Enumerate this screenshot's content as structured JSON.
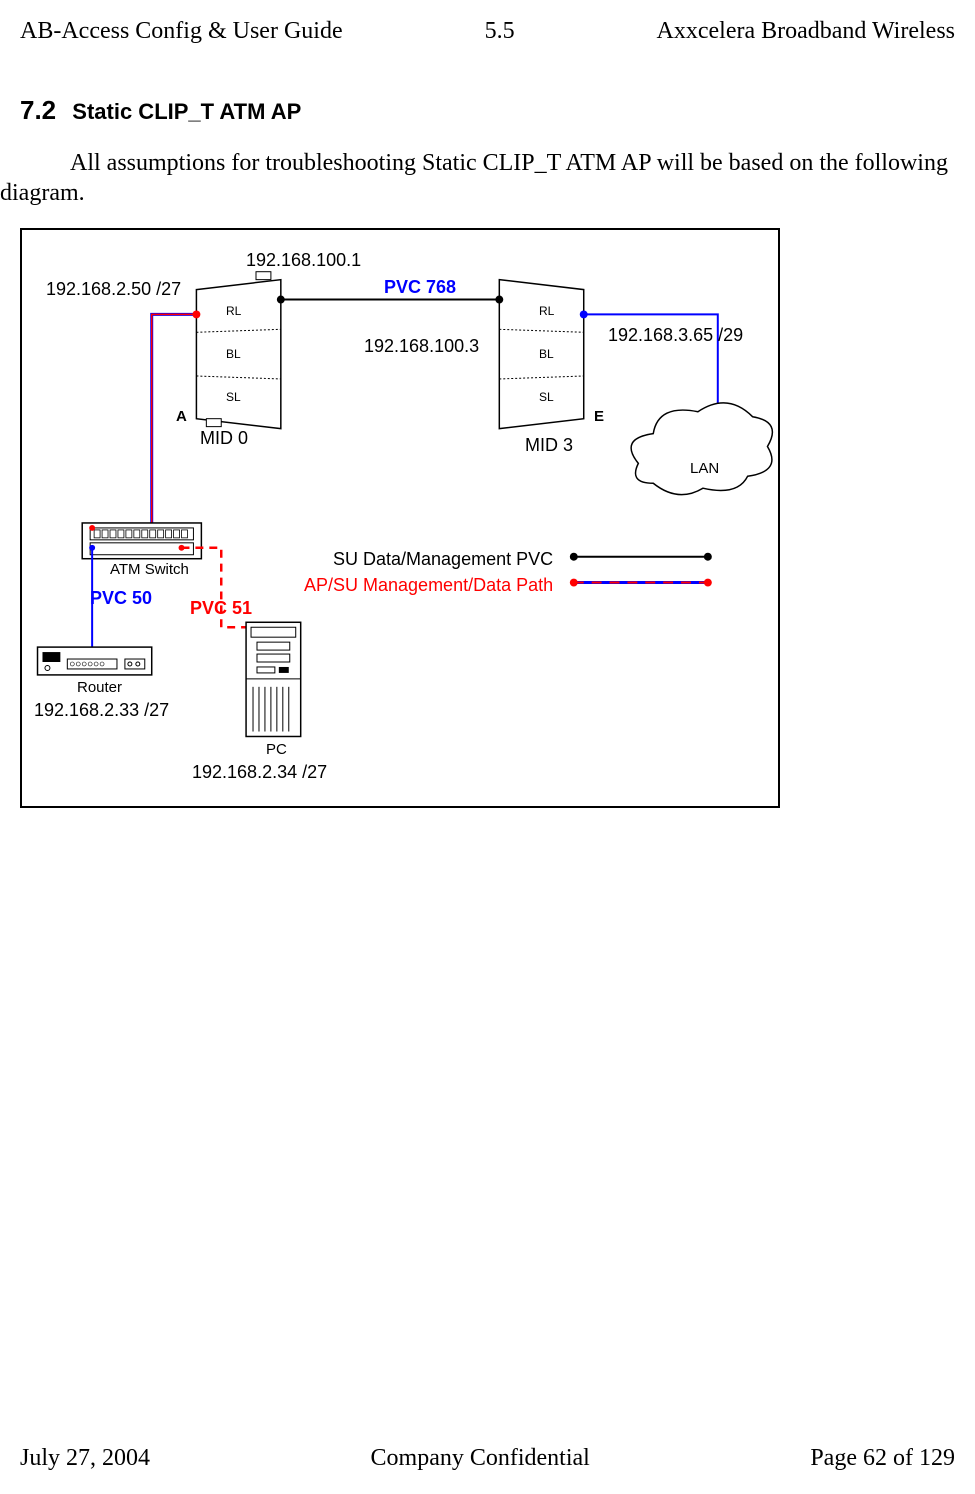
{
  "header": {
    "left": "AB-Access Config & User Guide",
    "center": "5.5",
    "right": "Axxcelera Broadband Wireless"
  },
  "footer": {
    "left": "July 27, 2004",
    "center": "Company Confidential",
    "right": "Page 62 of 129"
  },
  "section": {
    "number": "7.2",
    "title": "Static CLIP_T ATM AP"
  },
  "body": {
    "para1_line1": "All assumptions for troubleshooting Static CLIP_T ATM AP will be based on the following",
    "para1_line2": "diagram."
  },
  "diagram": {
    "ip_top": "192.168.100.1",
    "ip_left": "192.168.2.50  /27",
    "ip_mid": "192.168.100.3",
    "ip_right": "192.168.3.65 /29",
    "pvc768": "PVC 768",
    "nodeA_letter": "A",
    "nodeE_letter": "E",
    "rl": "RL",
    "bl": "BL",
    "sl": "SL",
    "mid0": "MID 0",
    "mid3": "MID 3",
    "lan": "LAN",
    "atm_switch": "ATM Switch",
    "pvc50": "PVC 50",
    "pvc51": "PVC 51",
    "router": "Router",
    "router_ip": "192.168.2.33  /27",
    "pc": "PC",
    "pc_ip": "192.168.2.34  /27",
    "legend_su": "SU Data/Management PVC",
    "legend_ap": "AP/SU  Management/",
    "legend_ap_red": "Data Path"
  }
}
